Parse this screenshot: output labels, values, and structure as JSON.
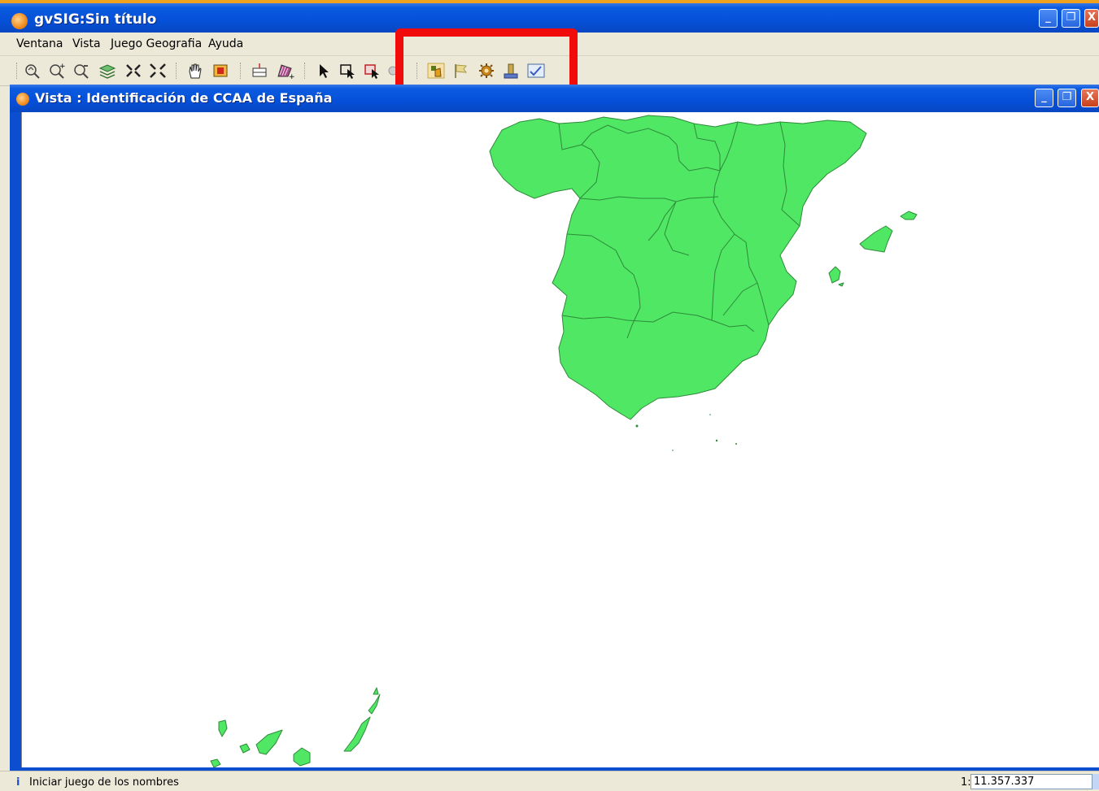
{
  "window": {
    "title": "gvSIG:Sin título",
    "controls": {
      "minimize": "_",
      "restore": "❐",
      "close": "X"
    }
  },
  "menu": {
    "items": [
      {
        "label": "Ventana"
      },
      {
        "label": "Vista"
      },
      {
        "label": "Juego Geografia"
      },
      {
        "label": "Ayuda"
      }
    ]
  },
  "toolbar": {
    "icons": [
      "zoom-previous-icon",
      "zoom-in-icon",
      "zoom-out-icon",
      "layers-icon",
      "zoom-to-full-extent-icon",
      "zoom-to-layer-icon",
      "pan-hand-icon",
      "frame-icon",
      "measure-distance-icon",
      "measure-area-icon",
      "select-pointer-icon",
      "select-by-rectangle-icon",
      "select-by-polygon-icon",
      "info-icon",
      "start-names-game-icon",
      "flag-icon",
      "settings-icon",
      "ranking-icon",
      "check-map-icon"
    ],
    "highlight_color": "#f10b0b"
  },
  "view": {
    "title": "Vista : Identificación de CCAA de España",
    "map_fill": "#4fe764",
    "map_stroke": "#2f8a3a",
    "background": "#ffffff"
  },
  "status": {
    "icon": "i",
    "message": "Iniciar juego de los nombres",
    "scale_prefix": "1:",
    "scale_value": "11.357.337"
  },
  "colors": {
    "titlebar": "#0550d8",
    "chrome": "#ece9d8"
  }
}
